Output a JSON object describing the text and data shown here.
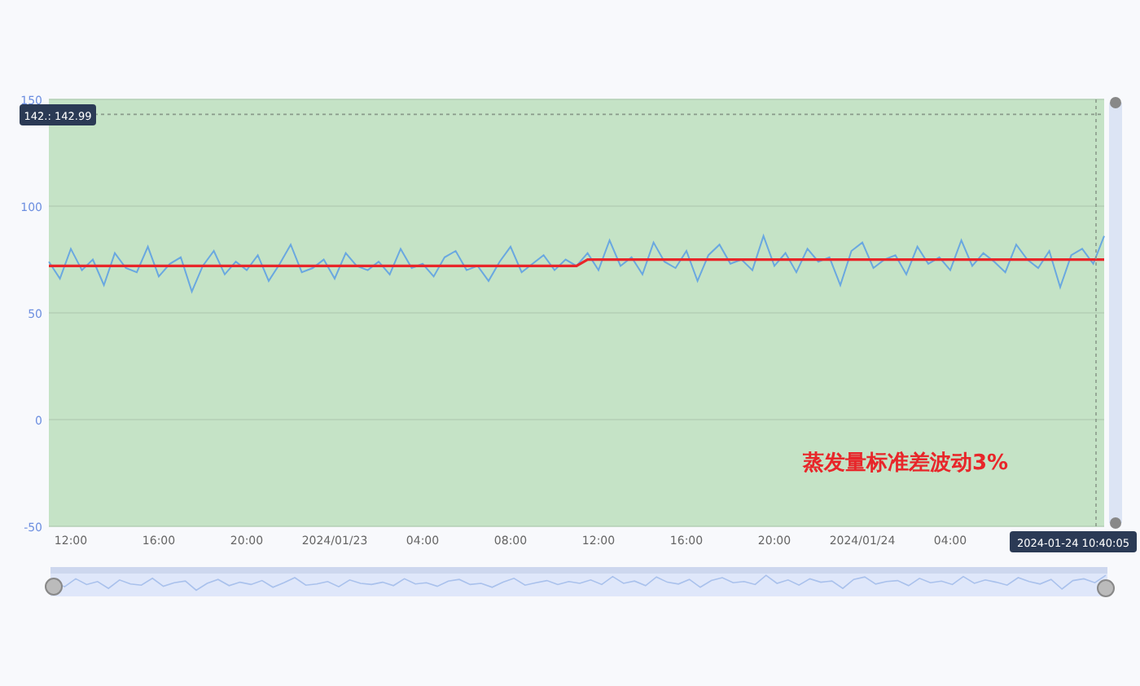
{
  "chart": {
    "chart_data": {
      "type": "line",
      "grid": true,
      "ref_lines": [
        {
          "axis": "y",
          "value": 142.99
        }
      ],
      "ylim": [
        -50,
        150
      ],
      "yticks": [
        -50,
        0,
        50,
        100,
        150
      ],
      "categories": [
        null,
        null,
        "12:00",
        null,
        null,
        null,
        null,
        null,
        null,
        null,
        "16:00",
        null,
        null,
        null,
        null,
        null,
        null,
        null,
        "20:00",
        null,
        null,
        null,
        null,
        null,
        null,
        null,
        "2024/01/23",
        null,
        null,
        null,
        null,
        null,
        null,
        null,
        "04:00",
        null,
        null,
        null,
        null,
        null,
        null,
        null,
        "08:00",
        null,
        null,
        null,
        null,
        null,
        null,
        null,
        "12:00",
        null,
        null,
        null,
        null,
        null,
        null,
        null,
        "16:00",
        null,
        null,
        null,
        null,
        null,
        null,
        null,
        "20:00",
        null,
        null,
        null,
        null,
        null,
        null,
        null,
        "2024/01/24",
        null,
        null,
        null,
        null,
        null,
        null,
        null,
        "04:00",
        null,
        null,
        null,
        null,
        null,
        null,
        null,
        null,
        null,
        null,
        null,
        null,
        null,
        null
      ],
      "series": [
        {
          "color": "#6aa8e0",
          "values": [
            74,
            66,
            80,
            70,
            75,
            63,
            78,
            71,
            69,
            81,
            67,
            73,
            76,
            60,
            72,
            79,
            68,
            74,
            70,
            77,
            65,
            73,
            82,
            69,
            71,
            75,
            66,
            78,
            72,
            70,
            74,
            68,
            80,
            71,
            73,
            67,
            76,
            79,
            70,
            72,
            65,
            74,
            81,
            69,
            73,
            77,
            70,
            75,
            72,
            78,
            70,
            84,
            72,
            76,
            68,
            83,
            74,
            71,
            79,
            65,
            77,
            82,
            73,
            75,
            70,
            86,
            72,
            78,
            69,
            80,
            74,
            76,
            63,
            79,
            83,
            71,
            75,
            77,
            68,
            81,
            73,
            76,
            70,
            84,
            72,
            78,
            74,
            69,
            82,
            75,
            71,
            79,
            62,
            77,
            80,
            73,
            86
          ]
        },
        {
          "color": "#e8262a",
          "values": [
            72,
            72,
            72,
            72,
            72,
            72,
            72,
            72,
            72,
            72,
            72,
            72,
            72,
            72,
            72,
            72,
            72,
            72,
            72,
            72,
            72,
            72,
            72,
            72,
            72,
            72,
            72,
            72,
            72,
            72,
            72,
            72,
            72,
            72,
            72,
            72,
            72,
            72,
            72,
            72,
            72,
            72,
            72,
            72,
            72,
            72,
            72,
            72,
            72,
            75,
            75,
            75,
            75,
            75,
            75,
            75,
            75,
            75,
            75,
            75,
            75,
            75,
            75,
            75,
            75,
            75,
            75,
            75,
            75,
            75,
            75,
            75,
            75,
            75,
            75,
            75,
            75,
            75,
            75,
            75,
            75,
            75,
            75,
            75,
            75,
            75,
            75,
            75,
            75,
            75,
            75,
            75,
            75,
            75,
            75,
            75,
            75
          ]
        }
      ],
      "annotations": [
        {
          "text": "蒸发量标准差波动3%"
        }
      ]
    },
    "y_pointer_label": "142.: 142.99",
    "x_pointer_label": "2024-01-24 10:40:05"
  }
}
